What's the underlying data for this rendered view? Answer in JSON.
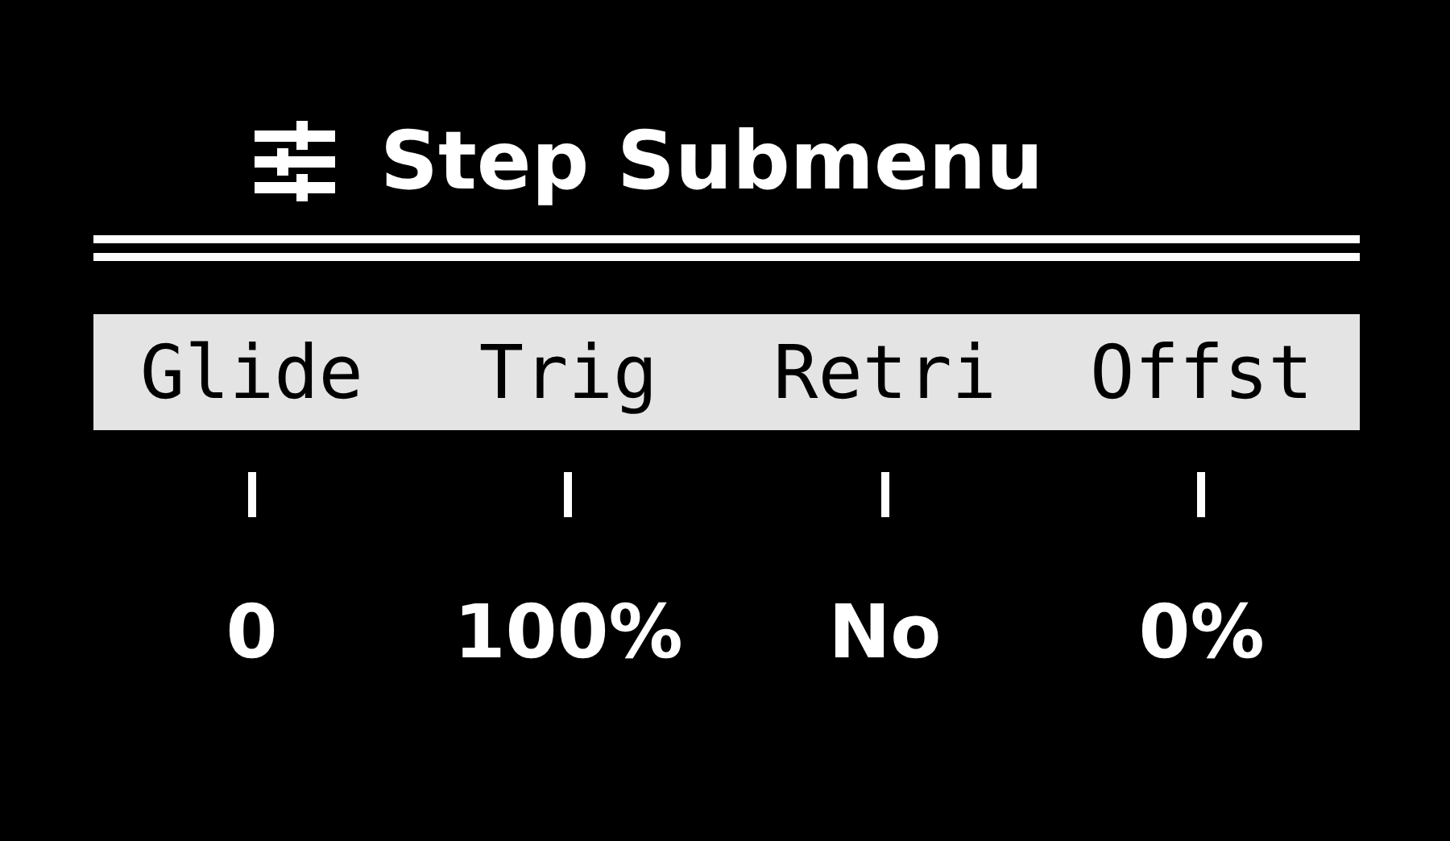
{
  "title": "Step Submenu",
  "parameter_bar": {
    "selected": true
  },
  "parameters": [
    {
      "label": "Glide",
      "value": "0"
    },
    {
      "label": "Trig",
      "value": "100%"
    },
    {
      "label": "Retri",
      "value": "No"
    },
    {
      "label": "Offst",
      "value": "0%"
    }
  ]
}
